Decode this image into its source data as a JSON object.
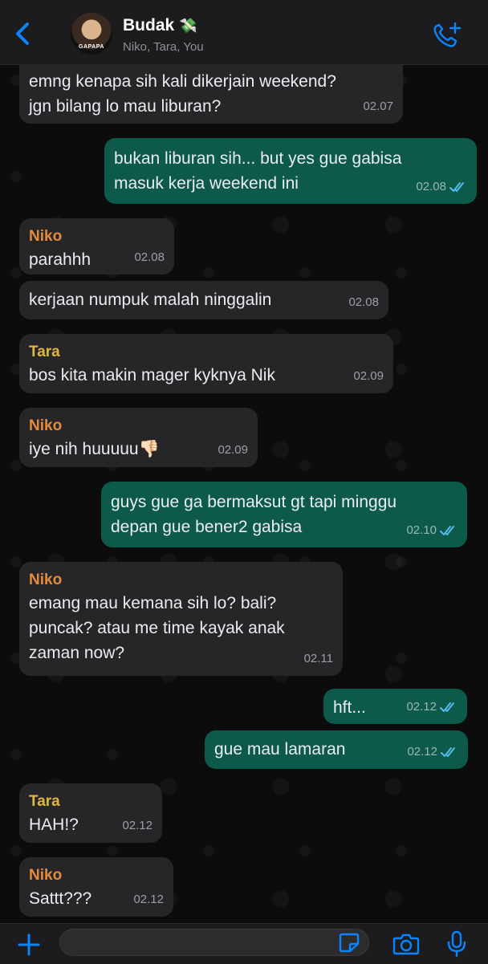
{
  "header": {
    "title": "Budak",
    "title_emoji": "💸",
    "subtitle": "Niko, Tara, You",
    "avatar_caption": "GAPAPA"
  },
  "colors": {
    "accent": "#0a84ff",
    "incoming_bubble": "#262628",
    "outgoing_bubble": "#0e5a4a",
    "niko_name": "#e58a3a",
    "tara_name": "#e0b83a"
  },
  "messages": [
    {
      "direction": "in",
      "sender": "",
      "lines": [
        "emng kenapa sih kali dikerjain weekend?",
        "jgn bilang lo mau liburan?"
      ],
      "time": "02.07"
    },
    {
      "direction": "out",
      "lines": [
        "bukan liburan sih... but yes gue gabisa",
        "masuk kerja weekend ini"
      ],
      "time": "02.08",
      "read": true
    },
    {
      "direction": "in",
      "sender": "Niko",
      "lines": [
        "parahhh"
      ],
      "time": "02.08"
    },
    {
      "direction": "in",
      "sender": "",
      "lines": [
        "kerjaan numpuk malah ninggalin"
      ],
      "time": "02.08"
    },
    {
      "direction": "in",
      "sender": "Tara",
      "lines": [
        "bos kita makin mager kyknya Nik"
      ],
      "time": "02.09"
    },
    {
      "direction": "in",
      "sender": "Niko",
      "lines": [
        "iye nih huuuuu👎🏻"
      ],
      "time": "02.09"
    },
    {
      "direction": "out",
      "lines": [
        "guys gue ga bermaksut gt tapi minggu",
        "depan gue bener2 gabisa"
      ],
      "time": "02.10",
      "read": true
    },
    {
      "direction": "in",
      "sender": "Niko",
      "lines": [
        "emang mau kemana sih lo? bali?",
        "puncak? atau me time kayak anak",
        "zaman now?"
      ],
      "time": "02.11"
    },
    {
      "direction": "out",
      "lines": [
        "hft..."
      ],
      "time": "02.12",
      "read": true
    },
    {
      "direction": "out",
      "lines": [
        "gue mau lamaran"
      ],
      "time": "02.12",
      "read": true
    },
    {
      "direction": "in",
      "sender": "Tara",
      "lines": [
        "HAH!?"
      ],
      "time": "02.12"
    },
    {
      "direction": "in",
      "sender": "Niko",
      "lines": [
        "Sattt???"
      ],
      "time": "02.12"
    }
  ],
  "footer": {
    "input_value": ""
  }
}
